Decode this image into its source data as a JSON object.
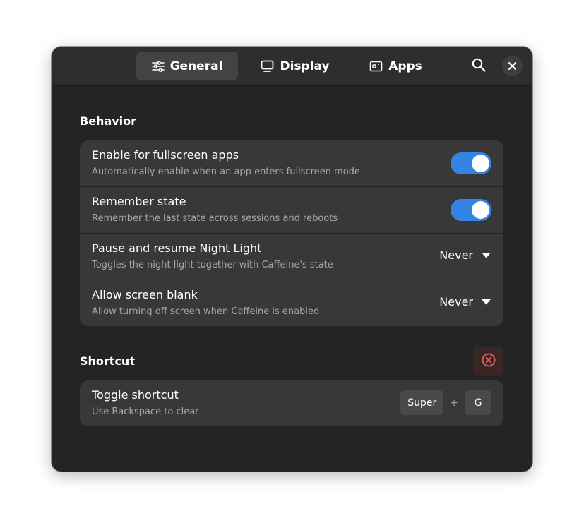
{
  "tabs": [
    {
      "label": "General",
      "icon": "sliders-icon",
      "active": true
    },
    {
      "label": "Display",
      "icon": "monitor-icon",
      "active": false
    },
    {
      "label": "Apps",
      "icon": "apps-window-icon",
      "active": false
    }
  ],
  "header": {
    "search_icon": "search-icon",
    "close_icon": "close-icon"
  },
  "behavior": {
    "title": "Behavior",
    "rows": [
      {
        "title": "Enable for fullscreen apps",
        "subtitle": "Automatically enable when an app enters fullscreen mode",
        "control": "switch",
        "on": true
      },
      {
        "title": "Remember state",
        "subtitle": "Remember the last state across sessions and reboots",
        "control": "switch",
        "on": true
      },
      {
        "title": "Pause and resume Night Light",
        "subtitle": "Toggles the night light together with Caffeine's state",
        "control": "dropdown",
        "value": "Never"
      },
      {
        "title": "Allow screen blank",
        "subtitle": "Allow turning off screen when Caffeine is enabled",
        "control": "dropdown",
        "value": "Never"
      }
    ]
  },
  "shortcut": {
    "title": "Shortcut",
    "clear_icon": "clear-circle-icon",
    "row": {
      "title": "Toggle shortcut",
      "subtitle": "Use Backspace to clear",
      "keys": [
        "Super",
        "G"
      ],
      "separator": "+"
    }
  },
  "colors": {
    "accent": "#3584e4",
    "window_bg": "#242424",
    "card_bg": "#383838",
    "destructive": "#e66464"
  }
}
